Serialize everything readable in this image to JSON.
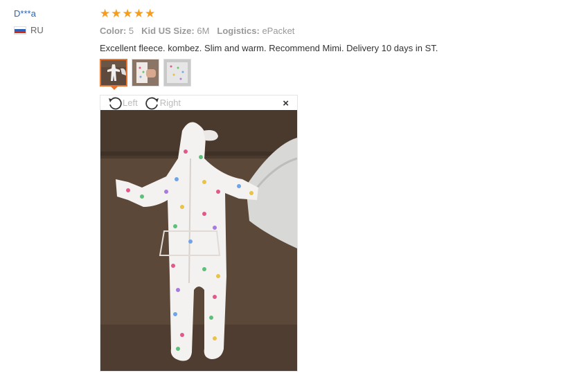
{
  "user": {
    "name": "D***a",
    "country": "RU"
  },
  "review": {
    "rating": 5,
    "stars": [
      "★",
      "★",
      "★",
      "★",
      "★"
    ],
    "attributes": [
      {
        "key": "Color:",
        "value": "5"
      },
      {
        "key": "Kid US Size:",
        "value": "6M"
      },
      {
        "key": "Logistics:",
        "value": "ePacket"
      }
    ],
    "text": "Excellent fleece. kombez. Slim and warm. Recommend Mimi. Delivery 10 days in ST."
  },
  "viewer": {
    "rotate_left": "Left",
    "rotate_right": "Right",
    "close": "×"
  },
  "colors": {
    "star": "#f79c1b",
    "link": "#2a66b5",
    "accent": "#e8742f"
  },
  "icons": [
    "flag-ru-icon",
    "rotate-left-icon",
    "rotate-right-icon",
    "close-icon",
    "star-icon"
  ]
}
